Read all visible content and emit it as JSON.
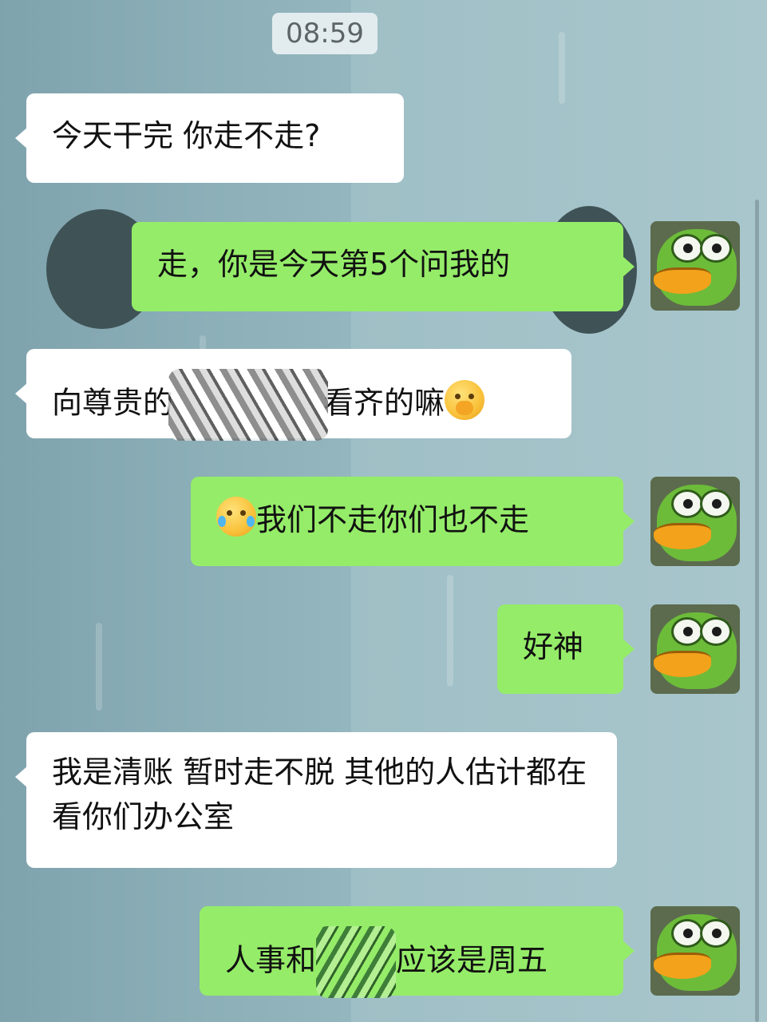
{
  "timestamp": "08:59",
  "messages": [
    {
      "side": "in",
      "text": "今天干完 你走不走?"
    },
    {
      "side": "out",
      "text": "走，你是今天第5个问我的"
    },
    {
      "side": "in",
      "text_before": "向尊贵的",
      "text_after": "看齐的嘛",
      "emoji": "hand-over-mouth-emoji"
    },
    {
      "side": "out",
      "emoji": "laughing-crying-emoji",
      "text": "我们不走你们也不走"
    },
    {
      "side": "out",
      "text": "好神"
    },
    {
      "side": "in",
      "text": "我是清账 暂时走不脱 其他的人估计都在看你们办公室"
    },
    {
      "side": "out",
      "text_before": "人事和",
      "text_after": "应该是周五"
    }
  ],
  "colors": {
    "incoming_bubble": "#ffffff",
    "outgoing_bubble": "#95ec69",
    "timestamp_bg": "#e2ecee"
  },
  "avatar": {
    "icon": "pepe-frog-avatar"
  }
}
